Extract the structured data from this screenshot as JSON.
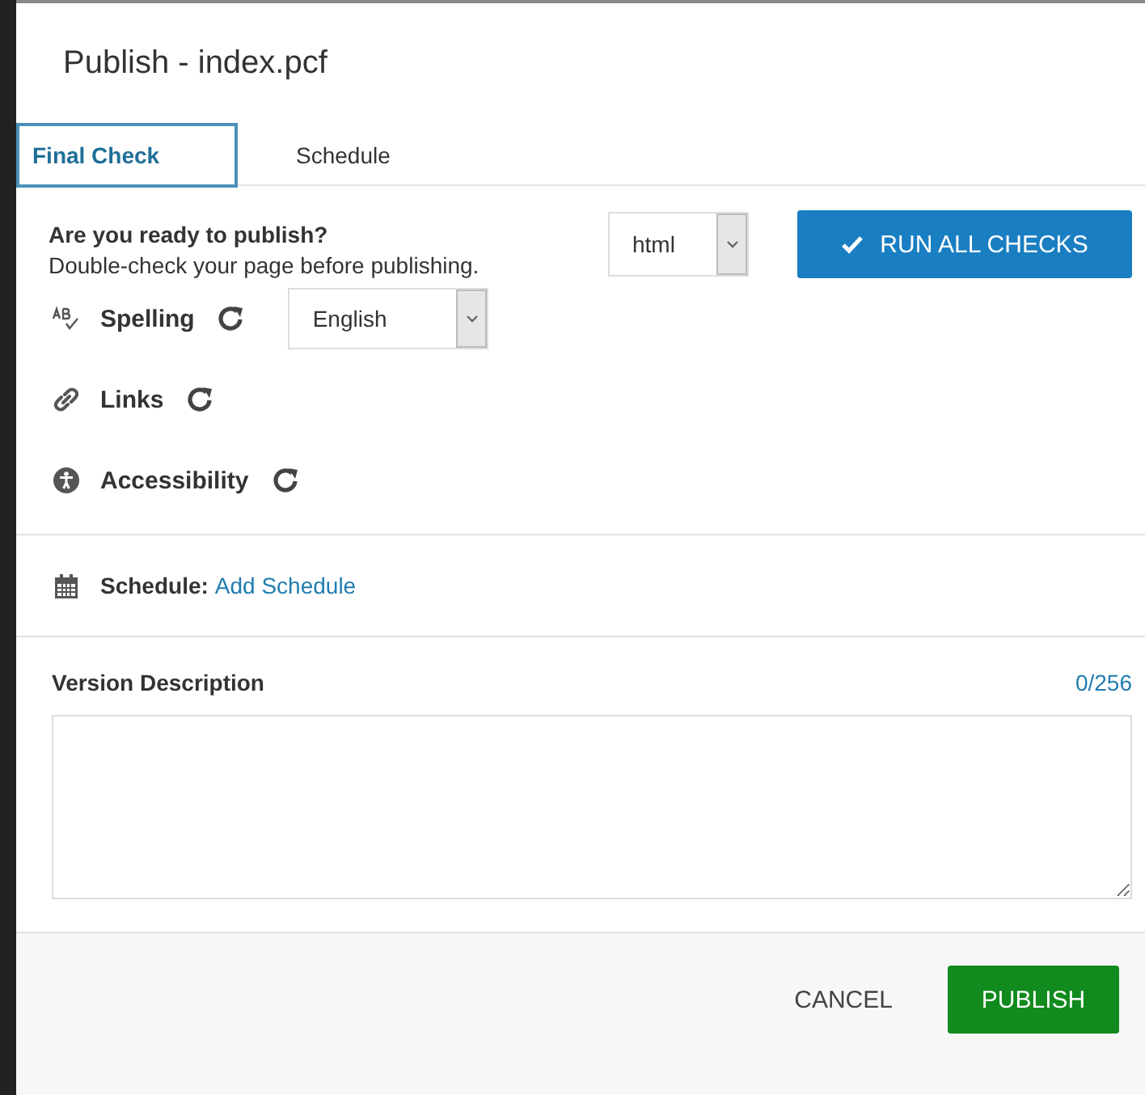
{
  "dialog": {
    "title": "Publish - index.pcf"
  },
  "tabs": [
    {
      "label": "Final Check",
      "selected": true
    },
    {
      "label": "Schedule",
      "selected": false
    }
  ],
  "intro": {
    "heading": "Are you ready to publish?",
    "text": "Double-check your page before publishing."
  },
  "format_select": {
    "value": "html"
  },
  "run_button": {
    "label": "RUN ALL CHECKS"
  },
  "checks": [
    {
      "kind": "spelling",
      "label": "Spelling",
      "language": "English"
    },
    {
      "kind": "links",
      "label": "Links"
    },
    {
      "kind": "accessibility",
      "label": "Accessibility"
    }
  ],
  "schedule": {
    "label": "Schedule:",
    "link": "Add Schedule"
  },
  "version_description": {
    "label": "Version Description",
    "counter": "0/256"
  },
  "buttons": {
    "cancel": "CANCEL",
    "publish": "PUBLISH"
  }
}
